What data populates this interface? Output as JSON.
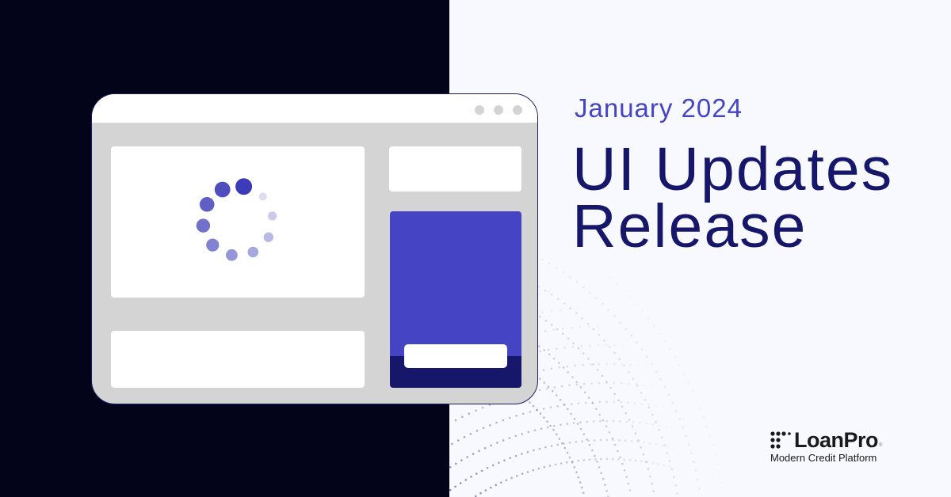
{
  "header": {
    "subtitle": "January 2024",
    "title_line1": "UI Updates",
    "title_line2": "Release"
  },
  "brand": {
    "name": "LoanPro",
    "registered_mark": "®",
    "tagline": "Modern Credit Platform",
    "logo_icon": "dot-grid-logo-icon"
  },
  "illustration": {
    "window_controls": [
      "dot",
      "dot",
      "dot"
    ],
    "loader_icon": "loading-spinner-icon"
  },
  "colors": {
    "dark_background": "#03031a",
    "light_background": "#f7f9fe",
    "accent_indigo": "#4444c4",
    "navy": "#16166a",
    "window_gray": "#d4d4d4"
  }
}
